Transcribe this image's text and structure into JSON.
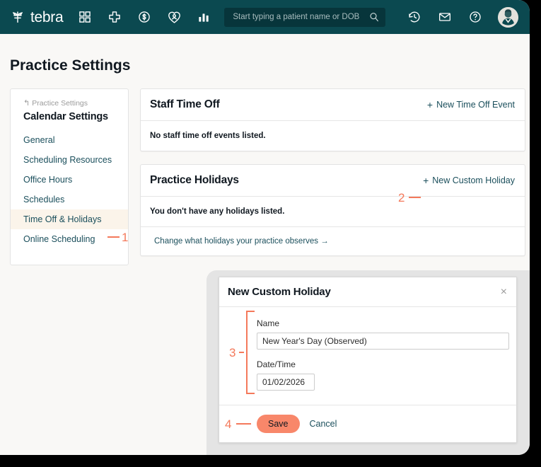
{
  "topnav": {
    "brand": "tebra",
    "brand_icon": "tebra-leaf-logo-icon",
    "nav_icons": [
      {
        "name": "dashboard-grid-icon",
        "label": "Dashboard"
      },
      {
        "name": "medical-cross-icon",
        "label": "Clinical"
      },
      {
        "name": "dollar-circle-icon",
        "label": "Billing"
      },
      {
        "name": "patient-heart-icon",
        "label": "Patients"
      },
      {
        "name": "bar-chart-icon",
        "label": "Reports"
      }
    ],
    "search": {
      "placeholder": "Start typing a patient name or DOB",
      "value": "",
      "icon": "search-icon"
    },
    "right_icons": [
      {
        "name": "history-clock-icon",
        "label": "Recent"
      },
      {
        "name": "envelope-icon",
        "label": "Messages"
      },
      {
        "name": "help-question-icon",
        "label": "Help"
      }
    ],
    "avatar": "user-avatar",
    "bg_color": "#0b4950"
  },
  "page": {
    "title": "Practice Settings"
  },
  "sidebar": {
    "breadcrumb": {
      "arrow": "↰",
      "label": "Practice Settings"
    },
    "heading": "Calendar Settings",
    "items": [
      {
        "label": "General",
        "active": false
      },
      {
        "label": "Scheduling Resources",
        "active": false
      },
      {
        "label": "Office Hours",
        "active": false
      },
      {
        "label": "Schedules",
        "active": false
      },
      {
        "label": "Time Off & Holidays",
        "active": true
      },
      {
        "label": "Online Scheduling",
        "active": false
      }
    ]
  },
  "staff_time_off": {
    "title": "Staff Time Off",
    "action_label": "New Time Off Event",
    "action_plus": "+",
    "empty_text": "No staff time off events listed."
  },
  "practice_holidays": {
    "title": "Practice Holidays",
    "action_label": "New Custom Holiday",
    "action_plus": "+",
    "empty_text": "You don't have any holidays listed.",
    "footer_link": "Change what holidays your practice observes →"
  },
  "modal": {
    "title": "New Custom Holiday",
    "close_icon": "×",
    "fields": {
      "name_label": "Name",
      "name_value": "New Year's Day (Observed)",
      "date_label": "Date/Time",
      "date_value": "01/02/2026"
    },
    "save_label": "Save",
    "cancel_label": "Cancel"
  },
  "annotations": {
    "color": "#f4795b",
    "markers": [
      {
        "number": "1",
        "target": "sidebar-item-time-off-holidays"
      },
      {
        "number": "2",
        "target": "new-custom-holiday-action"
      },
      {
        "number": "3",
        "target": "modal-form-fields"
      },
      {
        "number": "4",
        "target": "modal-save-button"
      }
    ]
  }
}
